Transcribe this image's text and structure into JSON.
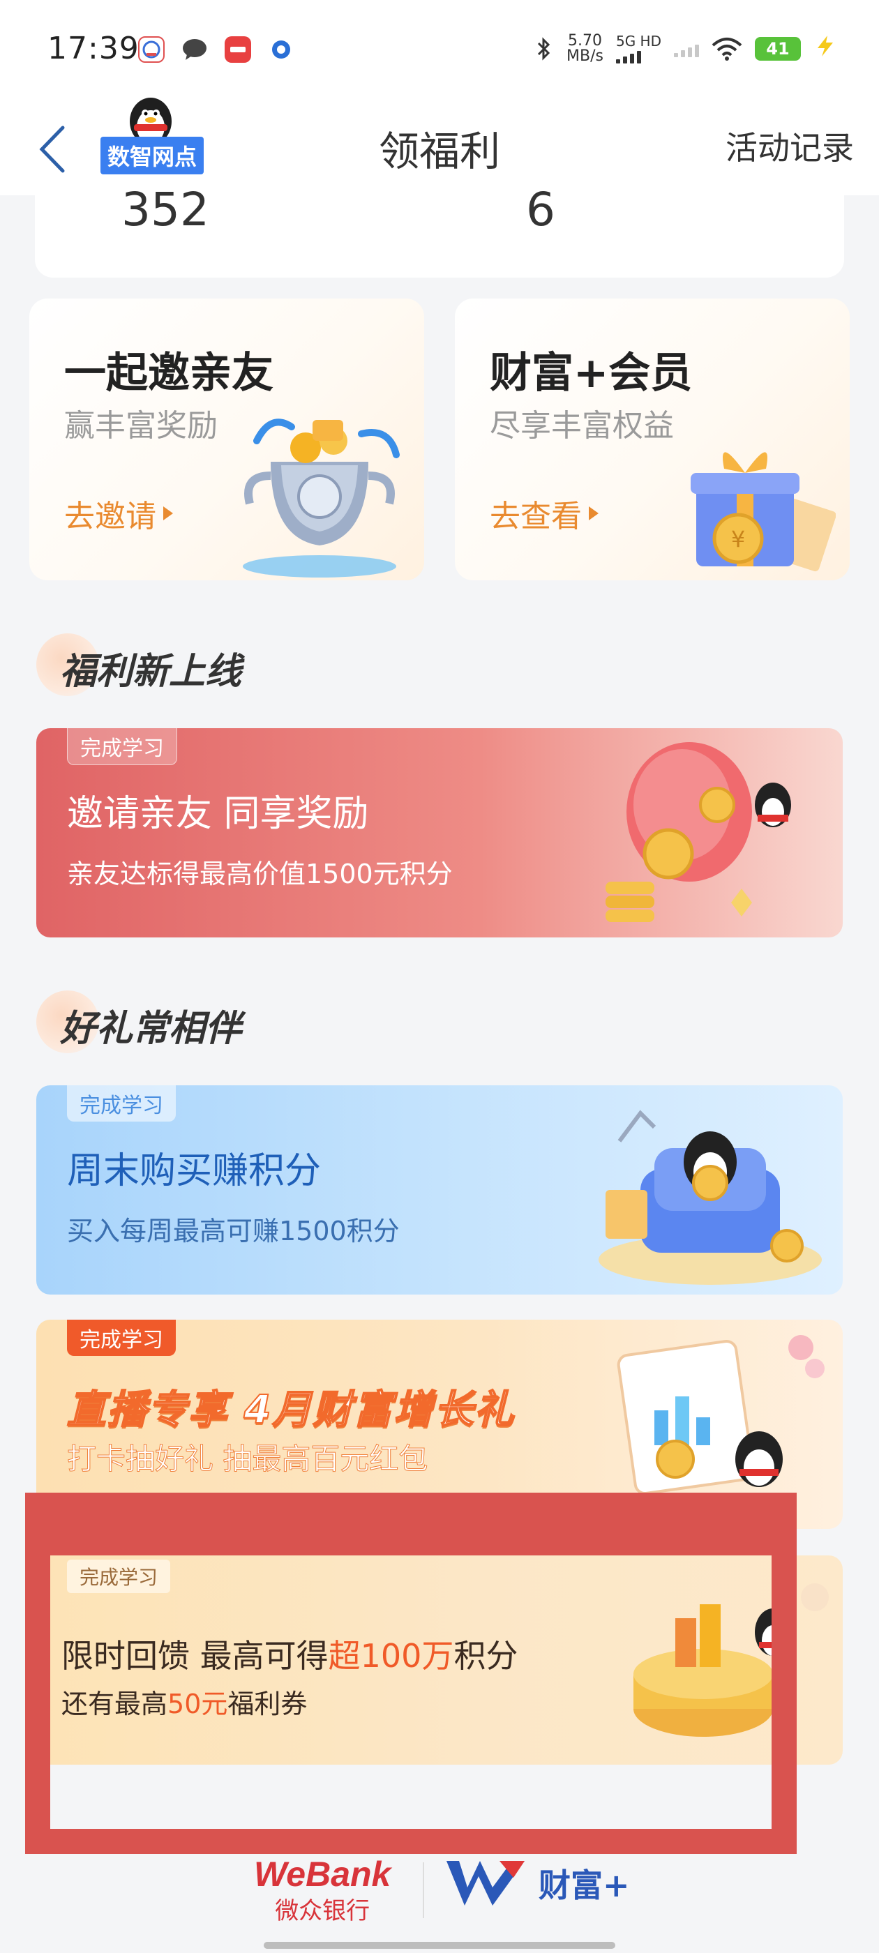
{
  "status_bar": {
    "time": "17:39",
    "app_icons": [
      "weibank-icon",
      "chat-icon",
      "miniapp-icon",
      "browser-icon"
    ],
    "net_speed_value": "5.70",
    "net_speed_unit": "MB/s",
    "network_label": "5G HD",
    "battery": "41"
  },
  "nav": {
    "logo_label": "数智网点",
    "title": "领福利",
    "right_action": "活动记录"
  },
  "stats": {
    "left_value": "352",
    "right_value": "6"
  },
  "feature_cards": [
    {
      "title": "一起邀亲友",
      "subtitle": "赢丰富奖励",
      "link": "去邀请"
    },
    {
      "title": "财富+会员",
      "subtitle": "尽享丰富权益",
      "link": "去查看"
    }
  ],
  "sections": {
    "new_benefits": "福利新上线",
    "gifts": "好礼常相伴"
  },
  "banners": {
    "invite": {
      "tag": "完成学习",
      "title": "邀请亲友 同享奖励",
      "subtitle": "亲友达标得最高价值1500元积分"
    },
    "weekend": {
      "tag": "完成学习",
      "title": "周末购买赚积分",
      "subtitle": "买入每周最高可赚1500积分"
    },
    "live": {
      "tag": "完成学习",
      "title": "直播专享 4月财富增长礼",
      "subtitle": "打卡抽好礼 抽最高百元红包"
    },
    "feedback": {
      "tag": "完成学习",
      "title_prefix": "限时回馈 最高可得",
      "title_highlight": "超100万",
      "title_suffix": "积分",
      "subtitle_prefix": "还有最高",
      "subtitle_highlight": "50元",
      "subtitle_suffix": "福利券"
    }
  },
  "footer": {
    "webank_en": "WeBank",
    "webank_cn": "微众银行",
    "wealth_label": "财富+"
  },
  "colors": {
    "accent_orange": "#e98a2f",
    "highlight_red": "#d9534f",
    "brand_red": "#d8343a",
    "brand_blue": "#2a58b8"
  }
}
